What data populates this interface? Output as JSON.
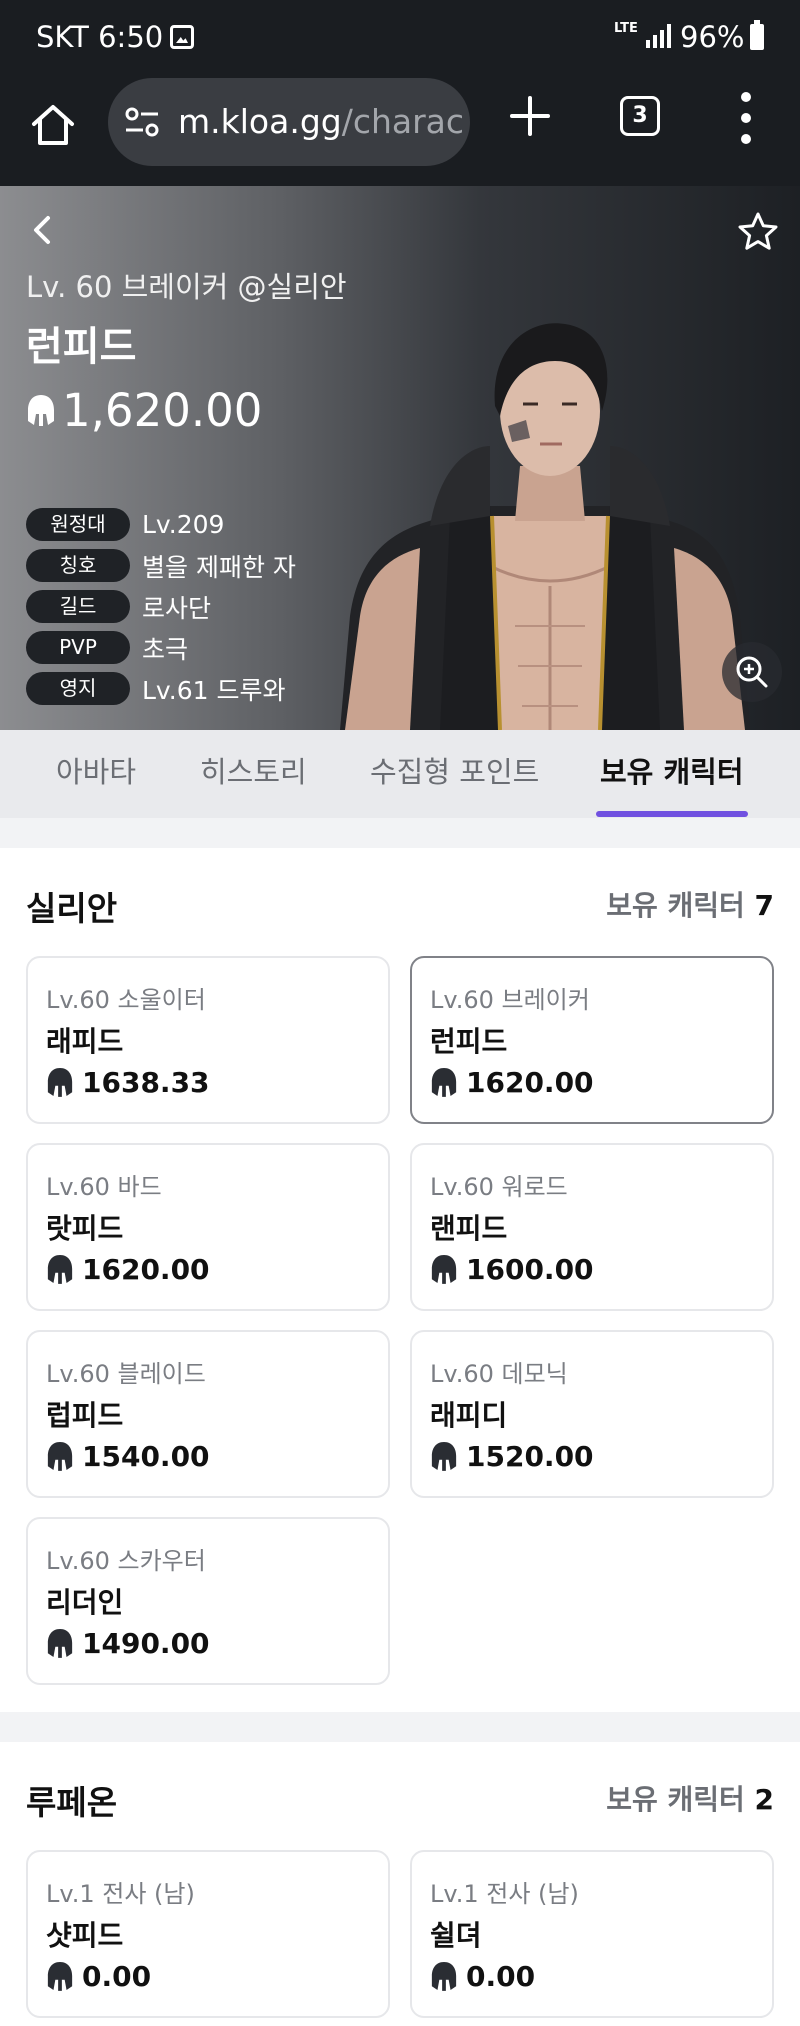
{
  "status_bar": {
    "time": "SKT 6:50",
    "network": "LTE",
    "battery": "96%"
  },
  "browser": {
    "url_host": "m.kloa.gg",
    "url_path": "/charac",
    "tab_count": "3"
  },
  "hero": {
    "class_line": "Lv. 60 브레이커 @실리안",
    "name": "런피드",
    "item_level": "1,620.00",
    "info": [
      {
        "label": "원정대",
        "value": "Lv.209"
      },
      {
        "label": "칭호",
        "value": "별을 제패한 자"
      },
      {
        "label": "길드",
        "value": "로사단"
      },
      {
        "label": "PVP",
        "value": "초극"
      },
      {
        "label": "영지",
        "value": "Lv.61 드루와"
      }
    ]
  },
  "tabs": [
    {
      "label": "아바타"
    },
    {
      "label": "히스토리"
    },
    {
      "label": "수집형 포인트"
    },
    {
      "label": "보유 캐릭터",
      "active": true
    }
  ],
  "servers": [
    {
      "name": "실리안",
      "count_label": "보유 캐릭터",
      "count": "7",
      "characters": [
        {
          "class": "Lv.60 소울이터",
          "name": "래피드",
          "ilvl": "1638.33"
        },
        {
          "class": "Lv.60 브레이커",
          "name": "런피드",
          "ilvl": "1620.00",
          "selected": true
        },
        {
          "class": "Lv.60 바드",
          "name": "랏피드",
          "ilvl": "1620.00"
        },
        {
          "class": "Lv.60 워로드",
          "name": "랜피드",
          "ilvl": "1600.00"
        },
        {
          "class": "Lv.60 블레이드",
          "name": "럽피드",
          "ilvl": "1540.00"
        },
        {
          "class": "Lv.60 데모닉",
          "name": "래피디",
          "ilvl": "1520.00"
        },
        {
          "class": "Lv.60 스카우터",
          "name": "리더인",
          "ilvl": "1490.00"
        }
      ]
    },
    {
      "name": "루페온",
      "count_label": "보유 캐릭터",
      "count": "2",
      "characters": [
        {
          "class": "Lv.1 전사 (남)",
          "name": "샷피드",
          "ilvl": "0.00"
        },
        {
          "class": "Lv.1 전사 (남)",
          "name": "쉴뎌",
          "ilvl": "0.00"
        }
      ]
    }
  ],
  "colors": {
    "accent": "#7050e0",
    "topbar": "#1a1d21",
    "page_bg": "#f2f3f5"
  }
}
